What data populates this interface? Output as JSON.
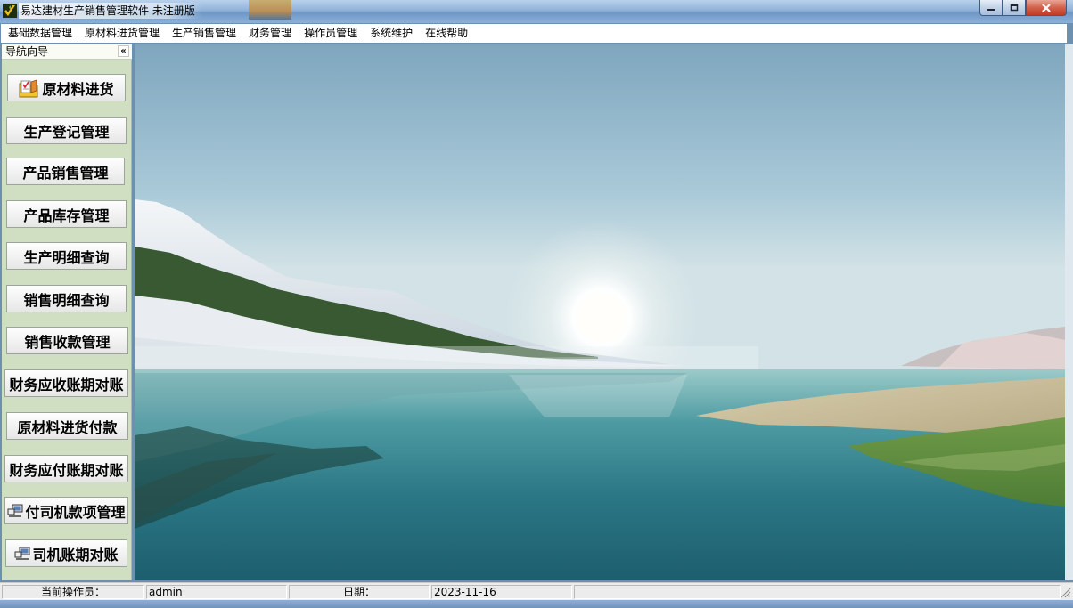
{
  "window": {
    "title": "易达建材生产销售管理软件 未注册版",
    "controls": {
      "minimize": "minimize-icon",
      "maximize": "maximize-icon",
      "close": "close-icon"
    }
  },
  "menu": [
    "基础数据管理",
    "原材料进货管理",
    "生产销售管理",
    "财务管理",
    "操作员管理",
    "系统维护",
    "在线帮助"
  ],
  "nav": {
    "title": "导航向导",
    "collapse_glyph": "«",
    "buttons": [
      {
        "label": "原材料进货",
        "icon": "folder-check-icon"
      },
      {
        "label": "生产登记管理"
      },
      {
        "label": "产品销售管理"
      },
      {
        "label": "产品库存管理"
      },
      {
        "label": "生产明细查询"
      },
      {
        "label": "销售明细查询"
      },
      {
        "label": "销售收款管理"
      },
      {
        "label": "财务应收账期对账"
      },
      {
        "label": "原材料进货付款"
      },
      {
        "label": "财务应付账期对账"
      },
      {
        "label": "付司机款项管理",
        "icon": "network-icon"
      },
      {
        "label": "司机账期对账",
        "icon": "network-icon"
      }
    ]
  },
  "status": {
    "operator_label": "当前操作员：",
    "operator_value": "admin",
    "date_label": "日期：",
    "date_value": "2023-11-16"
  },
  "colors": {
    "nav_background": "#d0dec2",
    "titlebar": "#8fb2d9",
    "close_button": "#c13a24"
  }
}
